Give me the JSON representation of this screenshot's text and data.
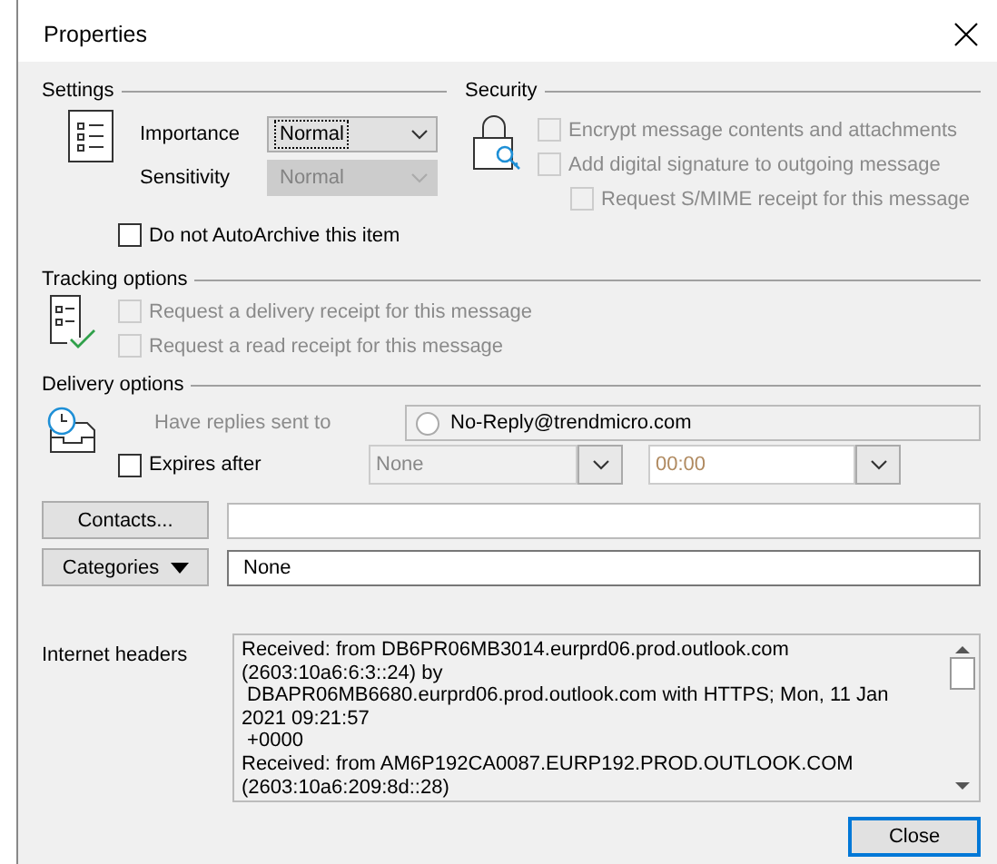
{
  "window": {
    "title": "Properties"
  },
  "settings": {
    "title": "Settings",
    "importance": {
      "label": "Importance",
      "value": "Normal",
      "disabled": false
    },
    "sensitivity": {
      "label": "Sensitivity",
      "value": "Normal",
      "disabled": true
    },
    "autoarchive": {
      "label": "Do not AutoArchive this item",
      "checked": false
    }
  },
  "security": {
    "title": "Security",
    "options": [
      {
        "label": "Encrypt message contents and attachments",
        "checked": false,
        "disabled": true
      },
      {
        "label": "Add digital signature to outgoing message",
        "checked": false,
        "disabled": true,
        "children": [
          {
            "label": "Request S/MIME receipt for this message",
            "checked": false,
            "disabled": true
          }
        ]
      }
    ]
  },
  "tracking": {
    "title": "Tracking options",
    "options": [
      {
        "label": "Request a delivery receipt for this message",
        "checked": false,
        "disabled": true
      },
      {
        "label": "Request a read receipt for this message",
        "checked": false,
        "disabled": true
      }
    ]
  },
  "delivery": {
    "title": "Delivery options",
    "replies": {
      "label": "Have replies sent to",
      "value": "No-Reply@trendmicro.com",
      "disabled": true
    },
    "expires": {
      "label": "Expires after",
      "checked": false,
      "date": "None",
      "time": "00:00"
    }
  },
  "contacts": {
    "label": "Contacts..."
  },
  "categories": {
    "label": "Categories",
    "value": "None"
  },
  "internet_headers": {
    "label": "Internet headers",
    "lines": [
      "Received: from DB6PR06MB3014.eurprd06.prod.outlook.com",
      "(2603:10a6:6:3::24) by",
      " DBAPR06MB6680.eurprd06.prod.outlook.com with HTTPS; Mon, 11 Jan",
      "2021 09:21:57",
      " +0000",
      "Received: from AM6P192CA0087.EURP192.PROD.OUTLOOK.COM",
      "(2603:10a6:209:8d::28)"
    ]
  },
  "buttons": [
    {
      "label": "Close",
      "default": true
    }
  ]
}
